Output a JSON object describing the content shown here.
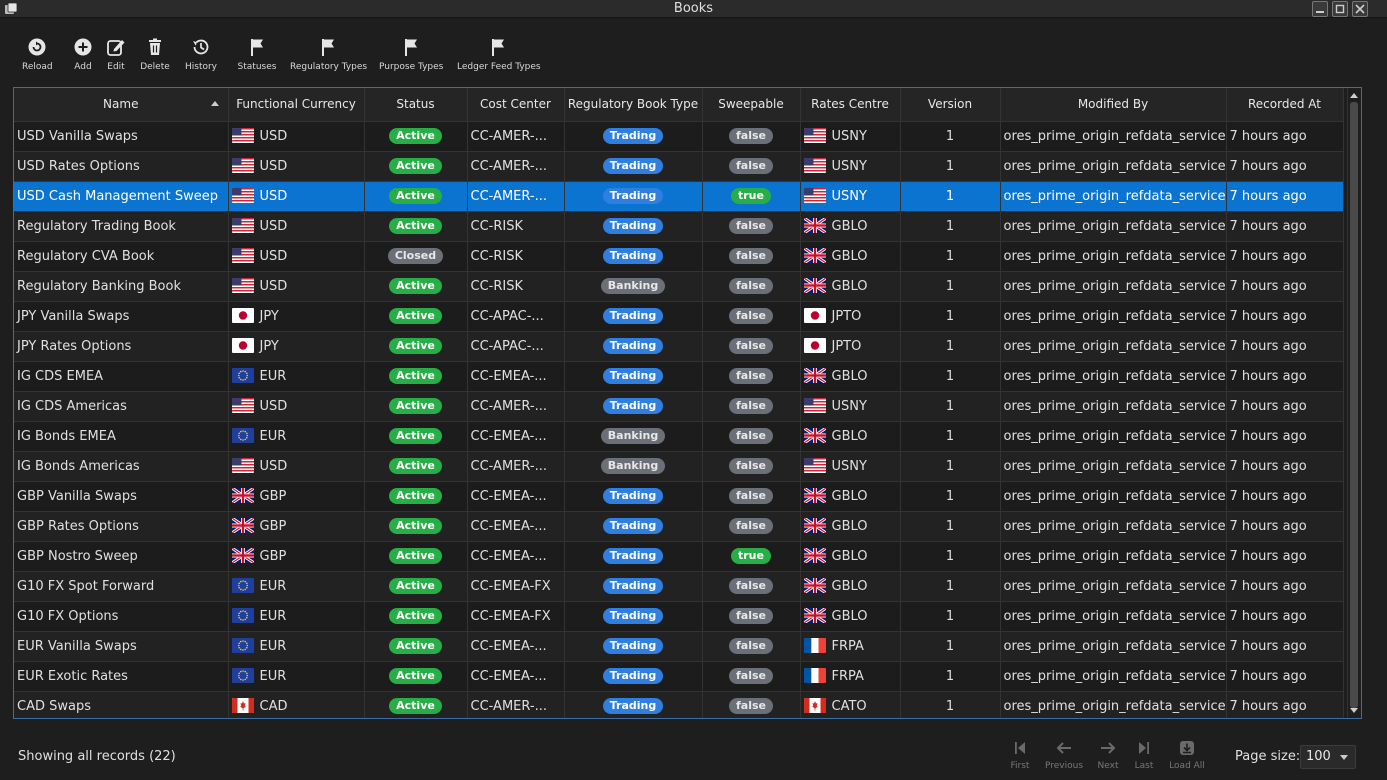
{
  "window": {
    "title": "Books"
  },
  "toolbar": {
    "items": [
      {
        "label": "Reload",
        "icon": "reload-icon"
      },
      {
        "label": "Add",
        "icon": "add-icon"
      },
      {
        "label": "Edit",
        "icon": "edit-icon"
      },
      {
        "label": "Delete",
        "icon": "delete-icon"
      },
      {
        "label": "History",
        "icon": "history-icon"
      },
      {
        "label": "Statuses",
        "icon": "flag-icon"
      },
      {
        "label": "Regulatory Types",
        "icon": "flag-icon"
      },
      {
        "label": "Purpose Types",
        "icon": "flag-icon"
      },
      {
        "label": "Ledger Feed Types",
        "icon": "flag-icon"
      }
    ]
  },
  "table": {
    "columns": [
      "Name",
      "Functional Currency",
      "Status",
      "Cost Center",
      "Regulatory Book Type",
      "Sweepable",
      "Rates Centre",
      "Version",
      "Modified By",
      "Recorded At"
    ],
    "rows": [
      {
        "name": "USD Vanilla Swaps",
        "ccy": "USD",
        "ccy_flag": "us",
        "status": "Active",
        "cost_center": "CC-AMER-...",
        "reg_type": "Trading",
        "sweepable": "false",
        "rates_centre": "USNY",
        "rc_flag": "us",
        "version": "1",
        "modified_by": "ores_prime_origin_refdata_service",
        "recorded_at": "7 hours ago"
      },
      {
        "name": "USD Rates Options",
        "ccy": "USD",
        "ccy_flag": "us",
        "status": "Active",
        "cost_center": "CC-AMER-...",
        "reg_type": "Trading",
        "sweepable": "false",
        "rates_centre": "USNY",
        "rc_flag": "us",
        "version": "1",
        "modified_by": "ores_prime_origin_refdata_service",
        "recorded_at": "7 hours ago"
      },
      {
        "name": "USD Cash Management Sweep",
        "ccy": "USD",
        "ccy_flag": "us",
        "status": "Active",
        "cost_center": "CC-AMER-...",
        "reg_type": "Trading",
        "sweepable": "true",
        "rates_centre": "USNY",
        "rc_flag": "us",
        "version": "1",
        "modified_by": "ores_prime_origin_refdata_service",
        "recorded_at": "7 hours ago",
        "selected": true
      },
      {
        "name": "Regulatory Trading Book",
        "ccy": "USD",
        "ccy_flag": "us",
        "status": "Active",
        "cost_center": "CC-RISK",
        "reg_type": "Trading",
        "sweepable": "false",
        "rates_centre": "GBLO",
        "rc_flag": "gb",
        "version": "1",
        "modified_by": "ores_prime_origin_refdata_service",
        "recorded_at": "7 hours ago"
      },
      {
        "name": "Regulatory CVA Book",
        "ccy": "USD",
        "ccy_flag": "us",
        "status": "Closed",
        "cost_center": "CC-RISK",
        "reg_type": "Trading",
        "sweepable": "false",
        "rates_centre": "GBLO",
        "rc_flag": "gb",
        "version": "1",
        "modified_by": "ores_prime_origin_refdata_service",
        "recorded_at": "7 hours ago"
      },
      {
        "name": "Regulatory Banking Book",
        "ccy": "USD",
        "ccy_flag": "us",
        "status": "Active",
        "cost_center": "CC-RISK",
        "reg_type": "Banking",
        "sweepable": "false",
        "rates_centre": "GBLO",
        "rc_flag": "gb",
        "version": "1",
        "modified_by": "ores_prime_origin_refdata_service",
        "recorded_at": "7 hours ago"
      },
      {
        "name": "JPY Vanilla Swaps",
        "ccy": "JPY",
        "ccy_flag": "jp",
        "status": "Active",
        "cost_center": "CC-APAC-...",
        "reg_type": "Trading",
        "sweepable": "false",
        "rates_centre": "JPTO",
        "rc_flag": "jp",
        "version": "1",
        "modified_by": "ores_prime_origin_refdata_service",
        "recorded_at": "7 hours ago"
      },
      {
        "name": "JPY Rates Options",
        "ccy": "JPY",
        "ccy_flag": "jp",
        "status": "Active",
        "cost_center": "CC-APAC-...",
        "reg_type": "Trading",
        "sweepable": "false",
        "rates_centre": "JPTO",
        "rc_flag": "jp",
        "version": "1",
        "modified_by": "ores_prime_origin_refdata_service",
        "recorded_at": "7 hours ago"
      },
      {
        "name": "IG CDS EMEA",
        "ccy": "EUR",
        "ccy_flag": "eu",
        "status": "Active",
        "cost_center": "CC-EMEA-...",
        "reg_type": "Trading",
        "sweepable": "false",
        "rates_centre": "GBLO",
        "rc_flag": "gb",
        "version": "1",
        "modified_by": "ores_prime_origin_refdata_service",
        "recorded_at": "7 hours ago"
      },
      {
        "name": "IG CDS Americas",
        "ccy": "USD",
        "ccy_flag": "us",
        "status": "Active",
        "cost_center": "CC-AMER-...",
        "reg_type": "Trading",
        "sweepable": "false",
        "rates_centre": "USNY",
        "rc_flag": "us",
        "version": "1",
        "modified_by": "ores_prime_origin_refdata_service",
        "recorded_at": "7 hours ago"
      },
      {
        "name": "IG Bonds EMEA",
        "ccy": "EUR",
        "ccy_flag": "eu",
        "status": "Active",
        "cost_center": "CC-EMEA-...",
        "reg_type": "Banking",
        "sweepable": "false",
        "rates_centre": "GBLO",
        "rc_flag": "gb",
        "version": "1",
        "modified_by": "ores_prime_origin_refdata_service",
        "recorded_at": "7 hours ago"
      },
      {
        "name": "IG Bonds Americas",
        "ccy": "USD",
        "ccy_flag": "us",
        "status": "Active",
        "cost_center": "CC-AMER-...",
        "reg_type": "Banking",
        "sweepable": "false",
        "rates_centre": "USNY",
        "rc_flag": "us",
        "version": "1",
        "modified_by": "ores_prime_origin_refdata_service",
        "recorded_at": "7 hours ago"
      },
      {
        "name": "GBP Vanilla Swaps",
        "ccy": "GBP",
        "ccy_flag": "gb",
        "status": "Active",
        "cost_center": "CC-EMEA-...",
        "reg_type": "Trading",
        "sweepable": "false",
        "rates_centre": "GBLO",
        "rc_flag": "gb",
        "version": "1",
        "modified_by": "ores_prime_origin_refdata_service",
        "recorded_at": "7 hours ago"
      },
      {
        "name": "GBP Rates Options",
        "ccy": "GBP",
        "ccy_flag": "gb",
        "status": "Active",
        "cost_center": "CC-EMEA-...",
        "reg_type": "Trading",
        "sweepable": "false",
        "rates_centre": "GBLO",
        "rc_flag": "gb",
        "version": "1",
        "modified_by": "ores_prime_origin_refdata_service",
        "recorded_at": "7 hours ago"
      },
      {
        "name": "GBP Nostro Sweep",
        "ccy": "GBP",
        "ccy_flag": "gb",
        "status": "Active",
        "cost_center": "CC-EMEA-...",
        "reg_type": "Trading",
        "sweepable": "true",
        "rates_centre": "GBLO",
        "rc_flag": "gb",
        "version": "1",
        "modified_by": "ores_prime_origin_refdata_service",
        "recorded_at": "7 hours ago"
      },
      {
        "name": "G10 FX Spot Forward",
        "ccy": "EUR",
        "ccy_flag": "eu",
        "status": "Active",
        "cost_center": "CC-EMEA-FX",
        "reg_type": "Trading",
        "sweepable": "false",
        "rates_centre": "GBLO",
        "rc_flag": "gb",
        "version": "1",
        "modified_by": "ores_prime_origin_refdata_service",
        "recorded_at": "7 hours ago"
      },
      {
        "name": "G10 FX Options",
        "ccy": "EUR",
        "ccy_flag": "eu",
        "status": "Active",
        "cost_center": "CC-EMEA-FX",
        "reg_type": "Trading",
        "sweepable": "false",
        "rates_centre": "GBLO",
        "rc_flag": "gb",
        "version": "1",
        "modified_by": "ores_prime_origin_refdata_service",
        "recorded_at": "7 hours ago"
      },
      {
        "name": "EUR Vanilla Swaps",
        "ccy": "EUR",
        "ccy_flag": "eu",
        "status": "Active",
        "cost_center": "CC-EMEA-...",
        "reg_type": "Trading",
        "sweepable": "false",
        "rates_centre": "FRPA",
        "rc_flag": "fr",
        "version": "1",
        "modified_by": "ores_prime_origin_refdata_service",
        "recorded_at": "7 hours ago"
      },
      {
        "name": "EUR Exotic Rates",
        "ccy": "EUR",
        "ccy_flag": "eu",
        "status": "Active",
        "cost_center": "CC-EMEA-...",
        "reg_type": "Trading",
        "sweepable": "false",
        "rates_centre": "FRPA",
        "rc_flag": "fr",
        "version": "1",
        "modified_by": "ores_prime_origin_refdata_service",
        "recorded_at": "7 hours ago"
      },
      {
        "name": "CAD Swaps",
        "ccy": "CAD",
        "ccy_flag": "ca",
        "status": "Active",
        "cost_center": "CC-AMER-...",
        "reg_type": "Trading",
        "sweepable": "false",
        "rates_centre": "CATO",
        "rc_flag": "ca",
        "version": "1",
        "modified_by": "ores_prime_origin_refdata_service",
        "recorded_at": "7 hours ago"
      }
    ]
  },
  "footer": {
    "showing": "Showing all records (22)",
    "pager": [
      {
        "label": "First",
        "icon": "first-page-icon"
      },
      {
        "label": "Previous",
        "icon": "previous-page-icon"
      },
      {
        "label": "Next",
        "icon": "next-page-icon"
      },
      {
        "label": "Last",
        "icon": "last-page-icon"
      },
      {
        "label": "Load All",
        "icon": "load-all-icon"
      }
    ],
    "page_size_label": "Page size:",
    "page_size_value": "100"
  },
  "colors": {
    "background": "#1e1e1e",
    "selected_row": "#0a74d0",
    "active_green": "#27ae47",
    "trading_blue": "#2f7fe0",
    "neutral_gray": "#6b6f78",
    "grid_border": "#3a6ea5"
  }
}
